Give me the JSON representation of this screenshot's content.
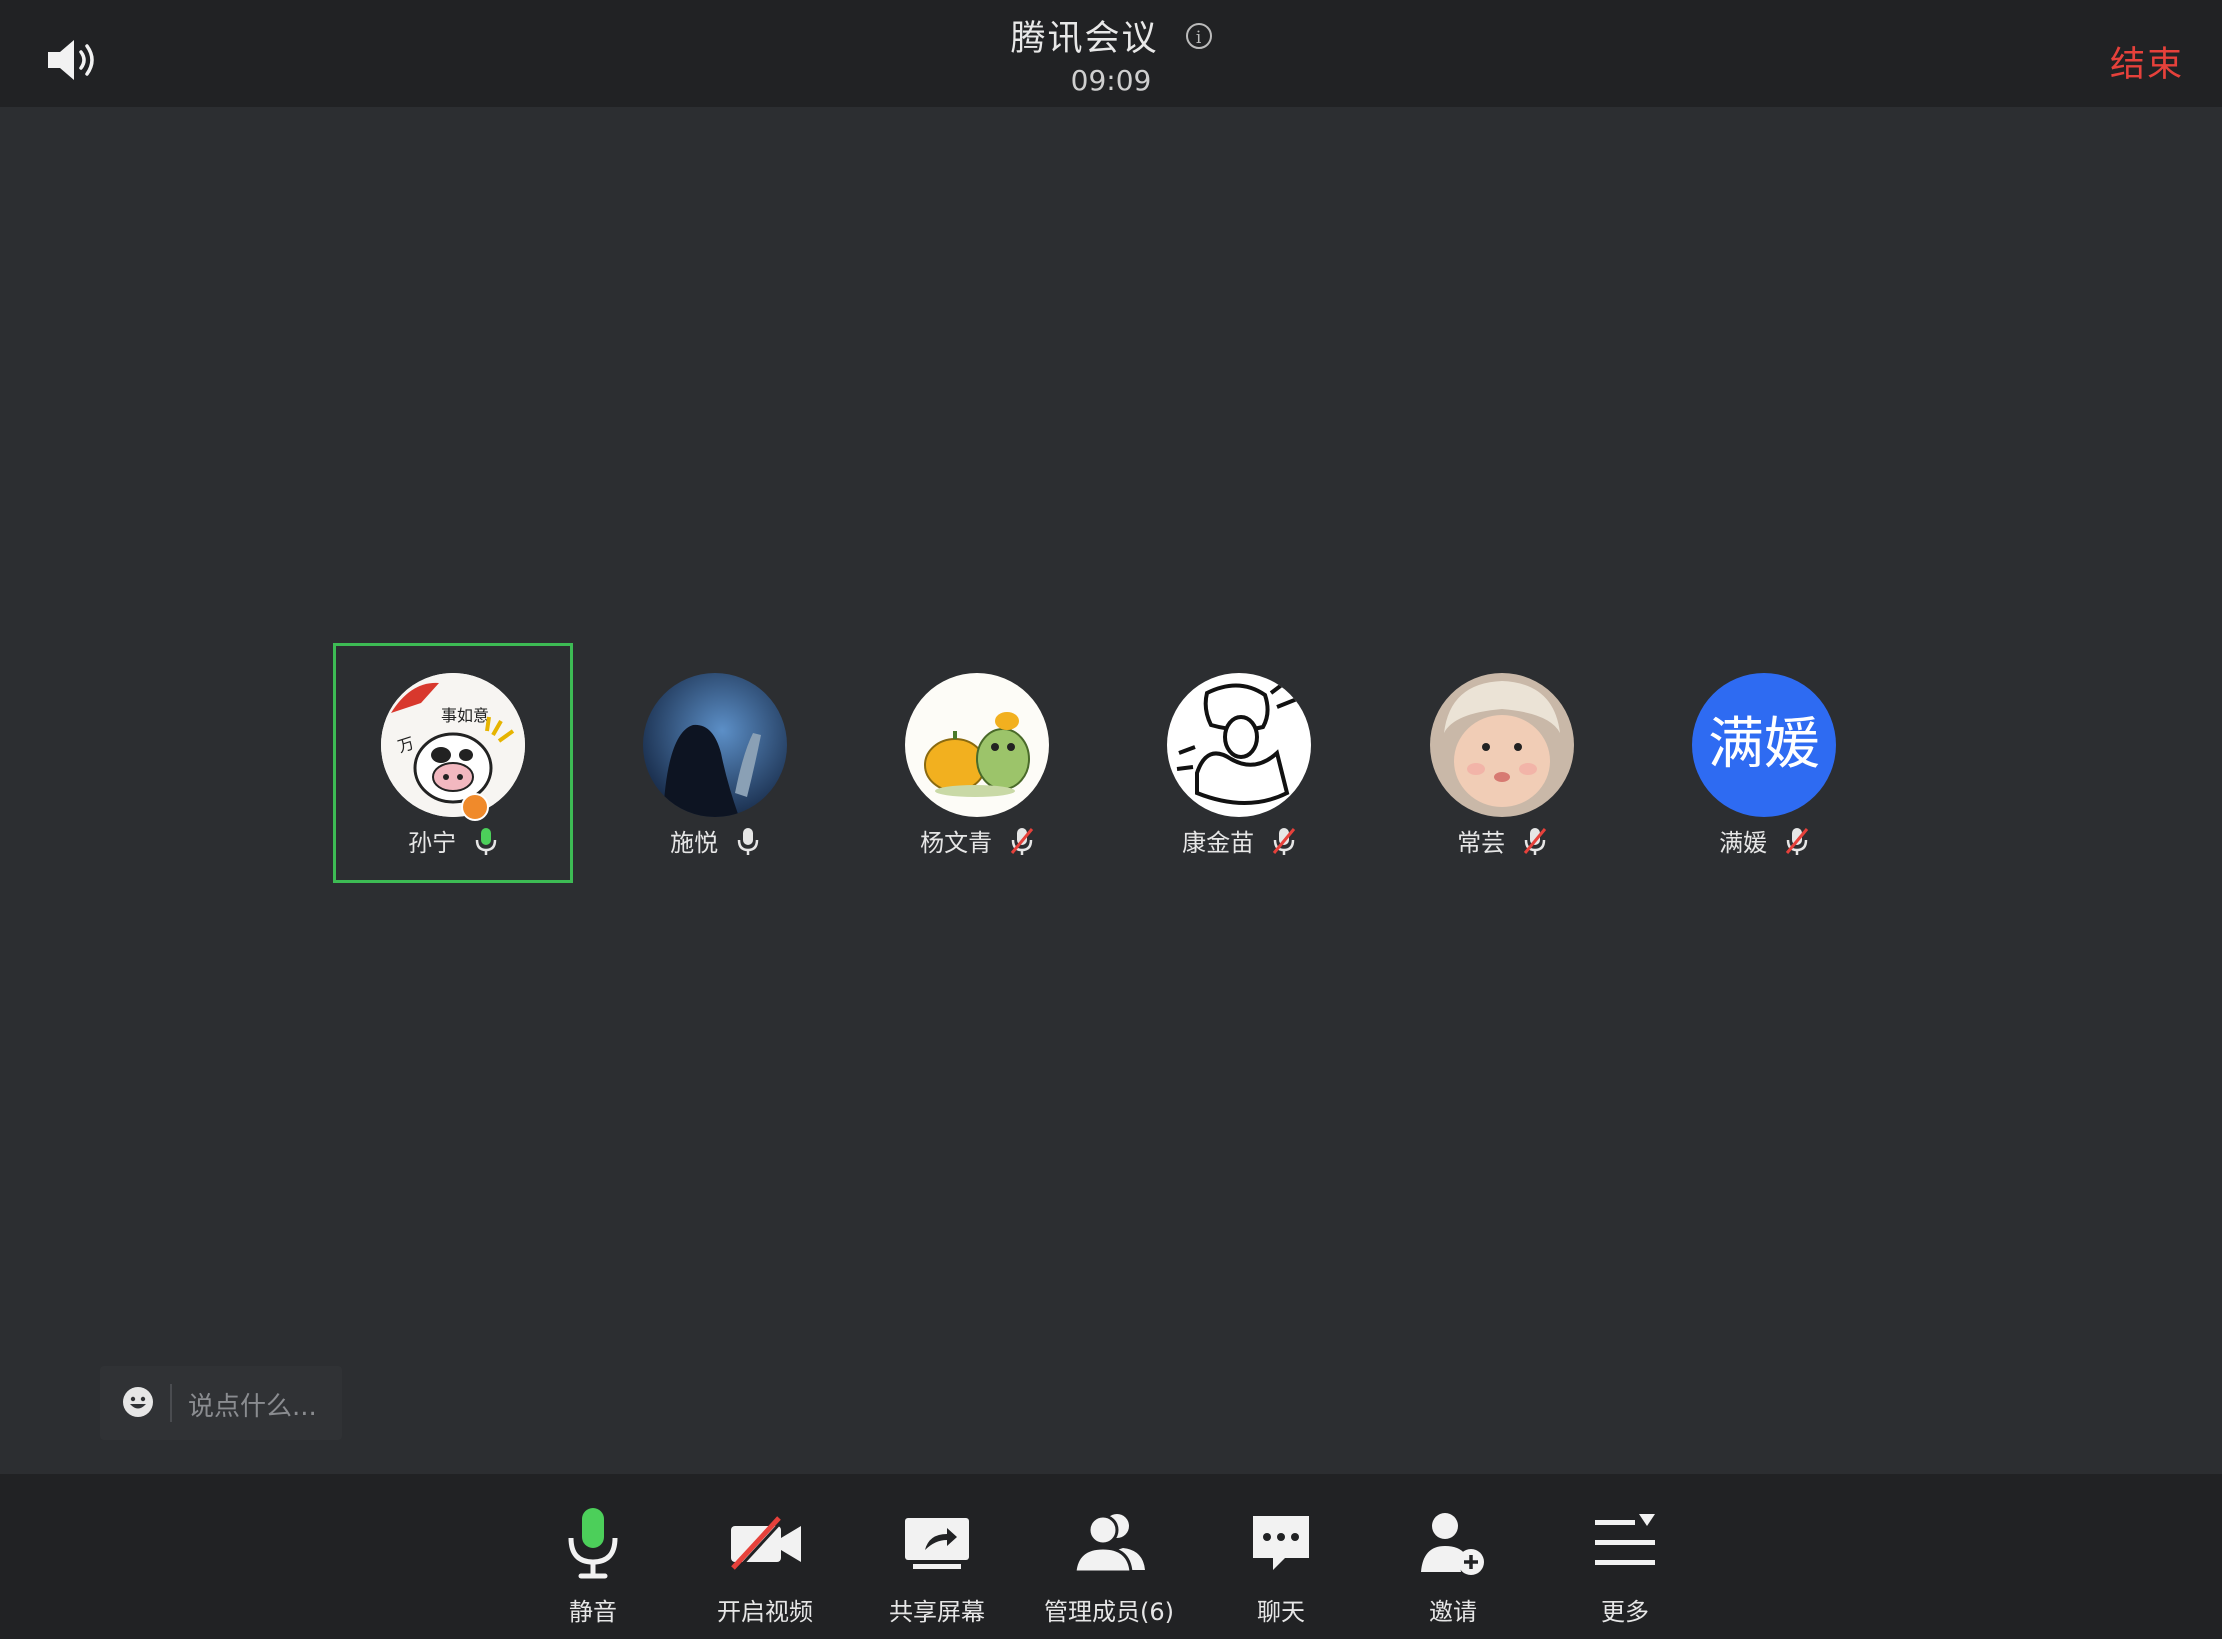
{
  "header": {
    "title": "腾讯会议",
    "timer": "09:09",
    "end_label": "结束",
    "speaker_icon": "speaker-icon",
    "info_icon": "info-icon",
    "accent_end": "#e6413b"
  },
  "participants": [
    {
      "name": "孙宁",
      "mic": "active",
      "avatar": "cow-sticker",
      "host": true,
      "speaking": true
    },
    {
      "name": "施悦",
      "mic": "on",
      "avatar": "photo"
    },
    {
      "name": "杨文青",
      "mic": "muted",
      "avatar": "frog-pumpkin"
    },
    {
      "name": "康金苗",
      "mic": "muted",
      "avatar": "sketch"
    },
    {
      "name": "常芸",
      "mic": "muted",
      "avatar": "baby-photo"
    },
    {
      "name": "满媛",
      "mic": "muted",
      "avatar": "initials",
      "initials": "满媛"
    }
  ],
  "chat": {
    "placeholder": "说点什么..."
  },
  "toolbar": {
    "items": [
      {
        "label": "静音",
        "icon": "microphone-icon"
      },
      {
        "label": "开启视频",
        "icon": "video-off-icon"
      },
      {
        "label": "共享屏幕",
        "icon": "share-screen-icon"
      },
      {
        "label": "管理成员(6)",
        "icon": "members-icon"
      },
      {
        "label": "聊天",
        "icon": "chat-icon"
      },
      {
        "label": "邀请",
        "icon": "invite-icon"
      },
      {
        "label": "更多",
        "icon": "more-icon"
      }
    ]
  },
  "colors": {
    "speaking_outline": "#3dbb54",
    "mic_active": "#4ccf5a",
    "mic_muted": "#e6413b",
    "initial_avatar_bg": "#2e6bf2"
  }
}
